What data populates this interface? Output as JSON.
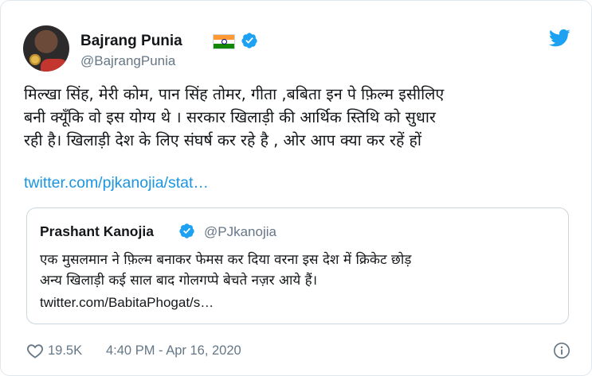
{
  "colors": {
    "link": "#1b95e0",
    "verified": "#1da1f2",
    "twitter_bird": "#1da1f2",
    "secondary_text": "#657786",
    "border": "#ccd6dd"
  },
  "tweet": {
    "author_name": "Bajrang Punia",
    "author_handle": "@BajrangPunia",
    "flag_icon": "india-flag-icon",
    "verified_icon": "verified-badge-icon",
    "platform_icon": "twitter-bird-icon",
    "text_lines": [
      "मिल्खा सिंह, मेरी कोम, पान सिंह तोमर, गीता ,बबिता  इन पे फ़िल्म इसीलिए",
      "बनी क्यूँकि वो इस योग्य थे । सरकार खिलाड़ी की आर्थिक स्तिथि को सुधार",
      "रही है। खिलाड़ी देश के लिए संघर्ष कर रहे है , ओर आप क्या कर रहें हों"
    ],
    "link": "twitter.com/pjkanojia/stat…",
    "quoted": {
      "author_name": "Prashant Kanojia",
      "author_handle": "@PJkanojia",
      "text_lines": [
        "एक मुसलमान ने फ़िल्म बनाकर फेमस कर दिया वरना इस देश में क्रिकेट छोड़",
        "अन्य खिलाड़ी कई साल बाद गोलगप्पे बेचते नज़र आये हैं।"
      ],
      "link": "twitter.com/BabitaPhogat/s…"
    },
    "likes": "19.5K",
    "timestamp": "4:40 PM - Apr 16, 2020",
    "like_icon": "heart-icon",
    "info_icon": "info-icon"
  }
}
